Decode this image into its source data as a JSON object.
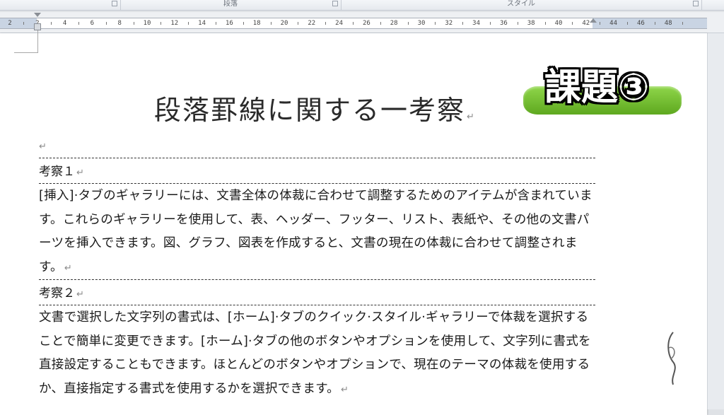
{
  "ribbon": {
    "groups": [
      {
        "id": "font",
        "label": ""
      },
      {
        "id": "paragraph",
        "label": "段落"
      },
      {
        "id": "styles",
        "label": "スタイル"
      }
    ]
  },
  "ruler": {
    "numbers": [
      "2",
      "2",
      "4",
      "6",
      "8",
      "10",
      "12",
      "14",
      "16",
      "18",
      "20",
      "22",
      "24",
      "26",
      "28",
      "30",
      "32",
      "34",
      "36",
      "38",
      "40",
      "42",
      "44",
      "46",
      "48"
    ]
  },
  "document": {
    "title": "段落罫線に関する一考察",
    "paragraph_mark": "↵",
    "badge": "課題③",
    "sections": [
      {
        "heading": "考察１",
        "body": "[挿入]·タブのギャラリーには、文書全体の体裁に合わせて調整するためのアイテムが含まれています。これらのギャラリーを使用して、表、ヘッダー、フッター、リスト、表紙や、その他の文書パーツを挿入できます。図、グラフ、図表を作成すると、文書の現在の体裁に合わせて調整されます。"
      },
      {
        "heading": "考察２",
        "body": "文書で選択した文字列の書式は、[ホーム]·タブのクイック·スタイル·ギャラリーで体裁を選択することで簡単に変更できます。[ホーム]·タブの他のボタンやオプションを使用して、文字列に書式を直接設定することもできます。ほとんどのボタンやオプションで、現在のテーマの体裁を使用するか、直接指定する書式を使用するかを選択できます。"
      }
    ]
  },
  "colors": {
    "badge_green": "#6cbf2a",
    "page": "#ffffff",
    "chrome": "#dfe2e6"
  }
}
